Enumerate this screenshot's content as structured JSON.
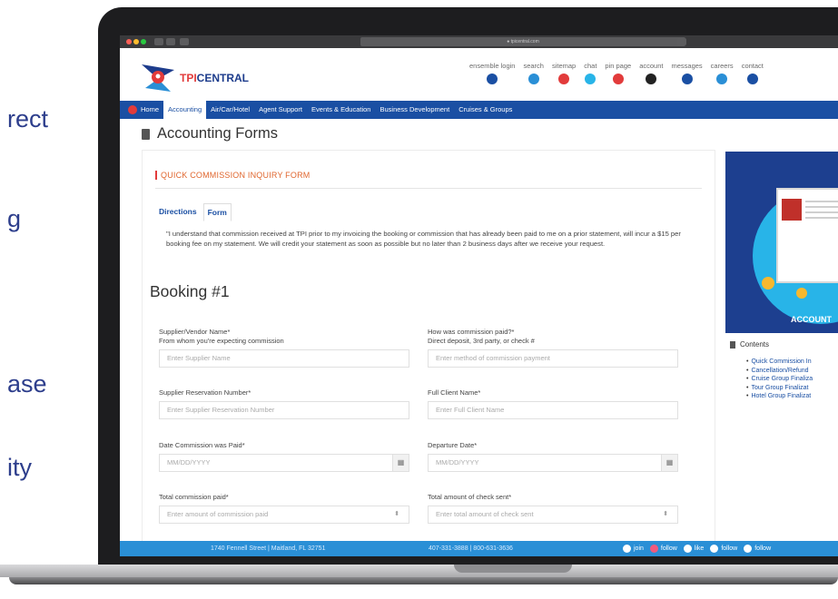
{
  "background_words": [
    "rect",
    "g",
    "ase",
    "ity"
  ],
  "browser": {
    "url": "● tpicentral.com"
  },
  "header": {
    "logo": {
      "name": "TPICENTRAL"
    },
    "links": [
      {
        "label": "ensemble login",
        "icon": "ensemble-icon",
        "color": "#1a4fa3"
      },
      {
        "label": "search",
        "icon": "search-icon",
        "color": "#2a8fd6"
      },
      {
        "label": "sitemap",
        "icon": "sitemap-icon",
        "color": "#e23b3b"
      },
      {
        "label": "chat",
        "icon": "chat-icon",
        "color": "#28b4e8"
      },
      {
        "label": "pin page",
        "icon": "pin-icon",
        "color": "#e23b3b"
      },
      {
        "label": "account",
        "icon": "account-icon",
        "color": "#222222"
      },
      {
        "label": "messages",
        "icon": "messages-icon",
        "color": "#1a4fa3"
      },
      {
        "label": "careers",
        "icon": "careers-icon",
        "color": "#2a8fd6"
      },
      {
        "label": "contact",
        "icon": "contact-icon",
        "color": "#1a4fa3"
      }
    ]
  },
  "nav": {
    "home": "Home",
    "items": [
      "Accounting",
      "Air/Car/Hotel",
      "Agent Support",
      "Events & Education",
      "Business Development",
      "Cruises & Groups"
    ]
  },
  "page": {
    "title": "Accounting Forms"
  },
  "form": {
    "heading": "QUICK COMMISSION INQUIRY FORM",
    "tabs": [
      "Directions",
      "Form"
    ],
    "disclaimer": "\"I understand that commission received at TPI prior to my invoicing the booking or commission that has already been paid to me on a prior statement, will incur a $15 per booking fee on my statement. We will credit your statement as soon as possible but no later than 2 business days after we receive your request.",
    "booking_title": "Booking #1",
    "fields": {
      "supplier_label": "Supplier/Vendor Name*",
      "supplier_sublabel": "From whom you're expecting commission",
      "supplier_placeholder": "Enter Supplier Name",
      "method_label": "How was commission paid?*",
      "method_sublabel": "Direct deposit, 3rd party, or check #",
      "method_placeholder": "Enter method of commission payment",
      "reservation_label": "Supplier Reservation Number*",
      "reservation_placeholder": "Enter Supplier Reservation Number",
      "client_label": "Full Client Name*",
      "client_placeholder": "Enter Full Client Name",
      "paid_date_label": "Date Commission was Paid*",
      "paid_date_placeholder": "MM/DD/YYYY",
      "departure_label": "Departure Date*",
      "departure_placeholder": "MM/DD/YYYY",
      "total_label": "Total commission paid*",
      "total_placeholder": "Enter amount of commission paid",
      "check_label": "Total amount of check sent*",
      "check_placeholder": "Enter total amount of check sent"
    }
  },
  "sidebar": {
    "promo_text": "ACCOUNT",
    "contents_title": "Contents",
    "contents_items": [
      "Quick Commission In",
      "Cancellation/Refund",
      "Cruise Group Finaliza",
      "Tour Group Finalizat",
      "Hotel Group Finalizat"
    ]
  },
  "footer": {
    "address": "1740 Fennell Street | Maitland, FL 32751",
    "phone": "407-331-3888 | 800-631-3636",
    "social": [
      {
        "icon": "facebook-icon",
        "label": "join"
      },
      {
        "icon": "instagram-icon",
        "label": "follow"
      },
      {
        "icon": "facebook-icon",
        "label": "like"
      },
      {
        "icon": "twitter-icon",
        "label": "follow"
      },
      {
        "icon": "linkedin-icon",
        "label": "follow"
      }
    ]
  }
}
